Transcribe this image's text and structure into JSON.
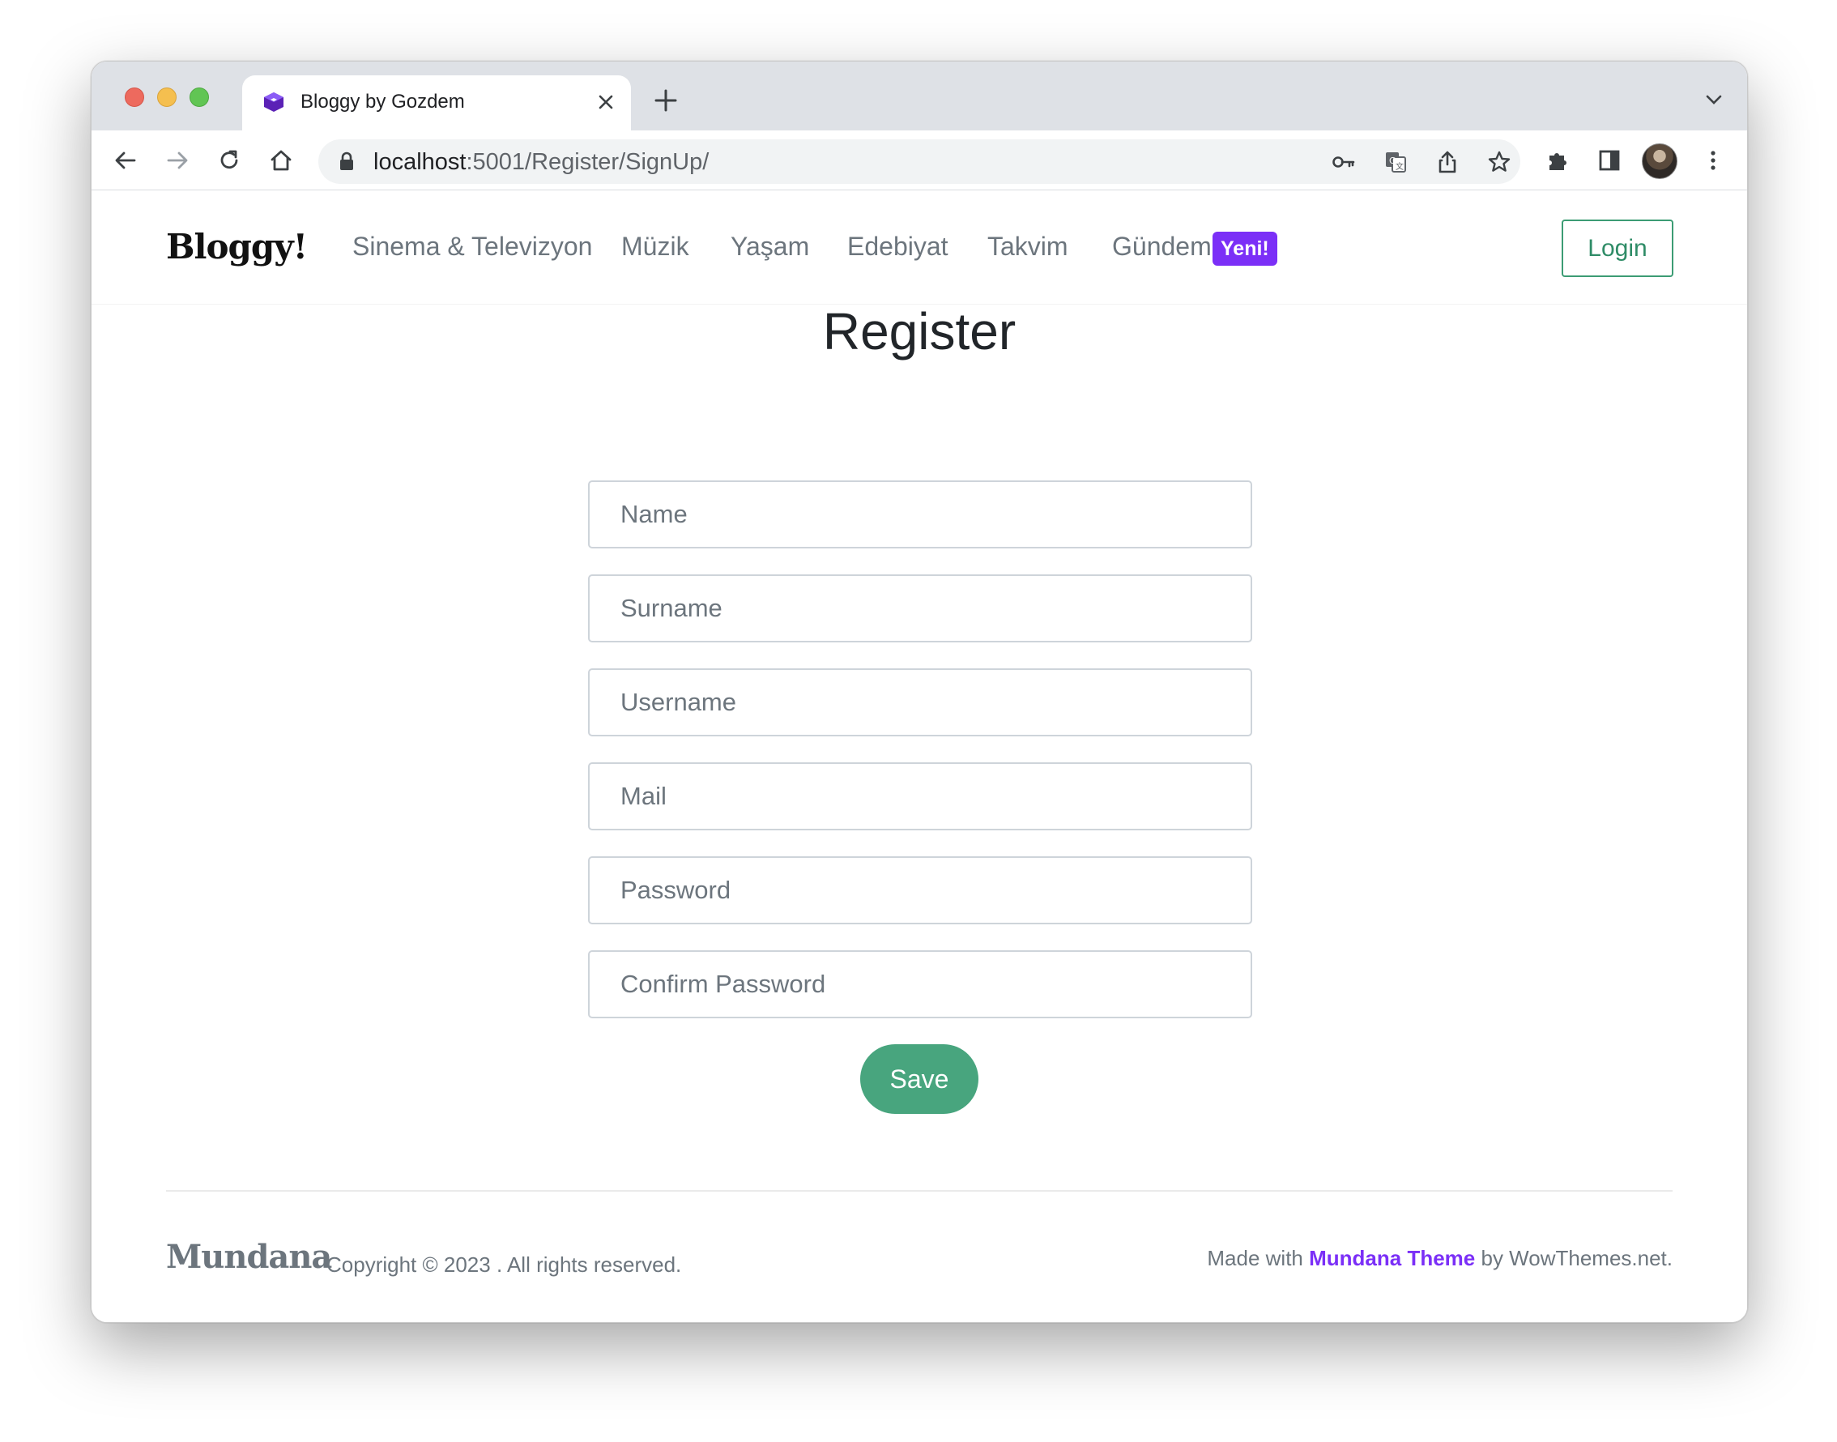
{
  "browser": {
    "tab_title": "Bloggy by Gozdem",
    "url_host": "localhost",
    "url_path": ":5001/Register/SignUp/"
  },
  "navbar": {
    "brand": "Bloggy!",
    "items": [
      {
        "label": "Sinema & Televizyon"
      },
      {
        "label": "Müzik"
      },
      {
        "label": "Yaşam"
      },
      {
        "label": "Edebiyat"
      },
      {
        "label": "Takvim"
      },
      {
        "label": "Gündem"
      }
    ],
    "badge": "Yeni!",
    "login_label": "Login"
  },
  "form": {
    "title": "Register",
    "fields": [
      {
        "placeholder": "Name",
        "value": ""
      },
      {
        "placeholder": "Surname",
        "value": ""
      },
      {
        "placeholder": "Username",
        "value": ""
      },
      {
        "placeholder": "Mail",
        "value": ""
      },
      {
        "placeholder": "Password",
        "value": ""
      },
      {
        "placeholder": "Confirm Password",
        "value": ""
      }
    ],
    "submit_label": "Save"
  },
  "footer": {
    "brand": "Mundana",
    "copyright": "Copyright © 2023 . All rights reserved.",
    "made_with_prefix": "Made with ",
    "theme_name": "Mundana Theme",
    "made_with_suffix": " by WowThemes.net."
  },
  "colors": {
    "accent_green": "#48a57e",
    "badge_purple": "#7b2ff7",
    "text_muted": "#6c757d"
  },
  "icons": [
    "back-icon",
    "forward-icon",
    "reload-icon",
    "home-icon",
    "lock-icon",
    "key-icon",
    "translate-icon",
    "share-icon",
    "star-icon",
    "extensions-icon",
    "side-panel-icon",
    "menu-icon"
  ]
}
